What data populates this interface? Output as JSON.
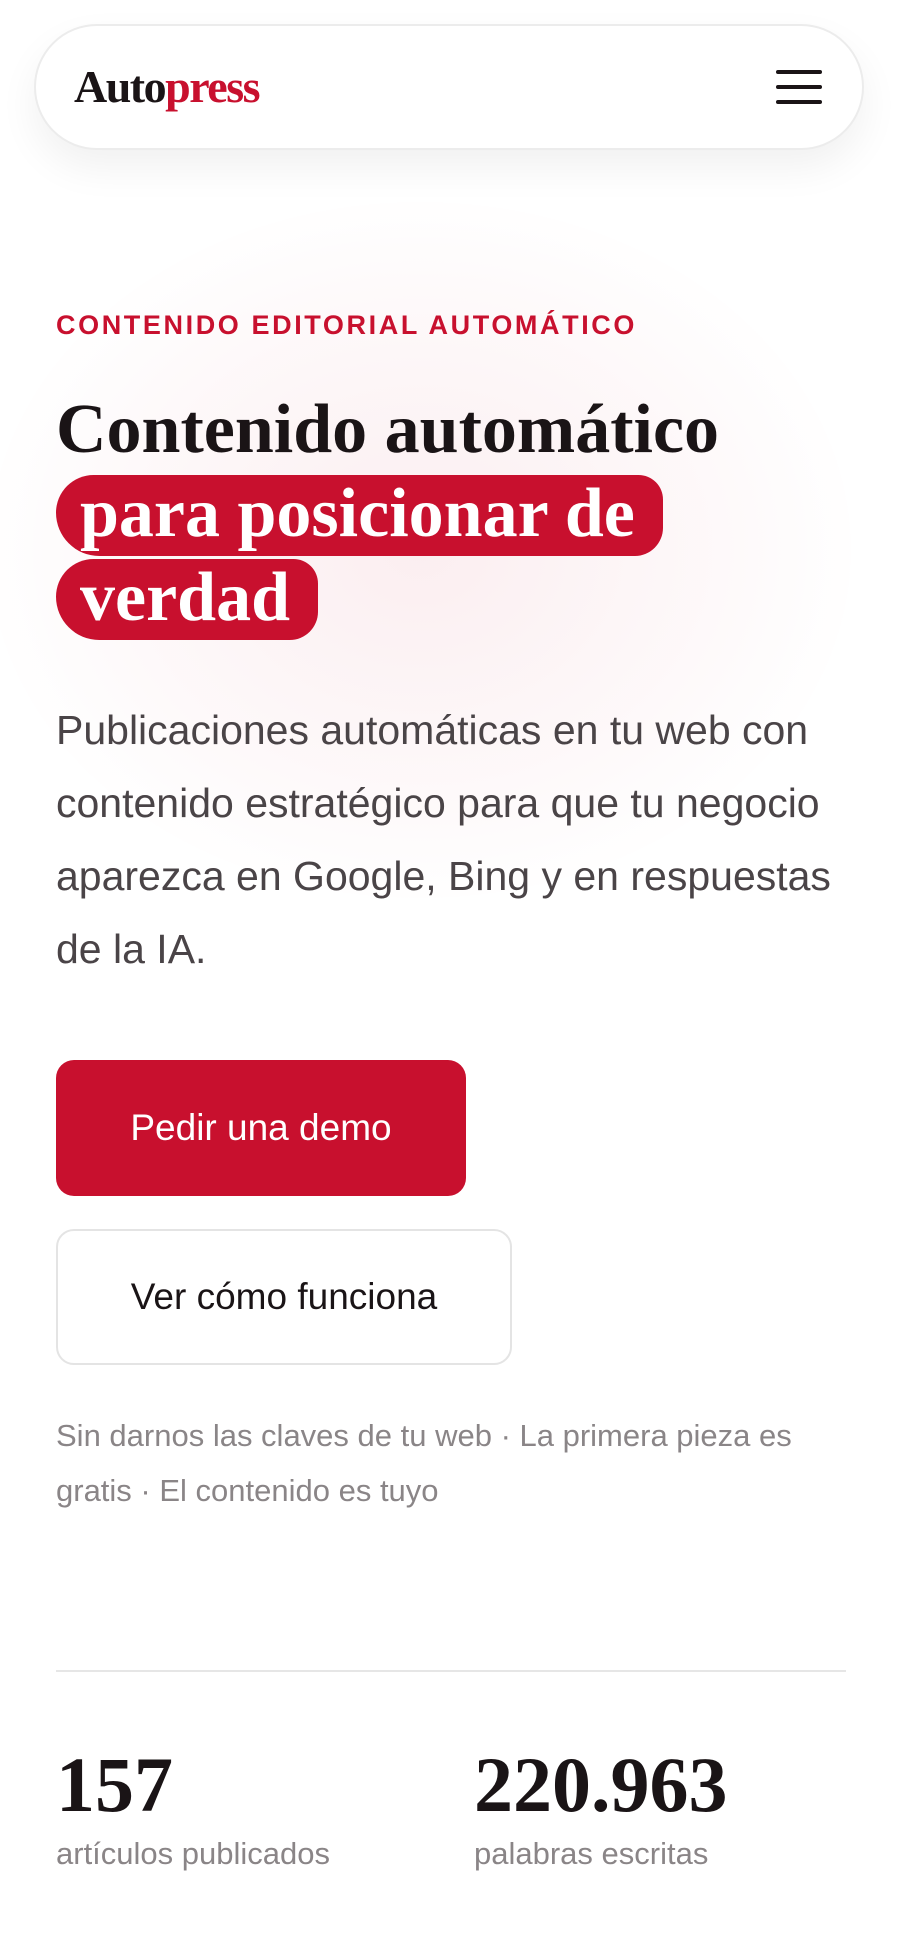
{
  "header": {
    "logo_part1": "Auto",
    "logo_part2": "press",
    "menu_icon": "hamburger-menu-icon"
  },
  "hero": {
    "eyebrow": "CONTENIDO EDITORIAL AUTOMÁTICO",
    "headline_plain": "Contenido automático",
    "headline_highlight": "para posicionar de verdad",
    "lead": "Publicaciones automáticas en tu web con contenido estratégico para que tu negocio aparezca en Google, Bing y en respuestas de la IA.",
    "primary_cta": "Pedir una demo",
    "secondary_cta": "Ver cómo funciona",
    "fineprint": "Sin darnos las claves de tu web · La primera pieza es gratis · El contenido es tuyo"
  },
  "stats": [
    {
      "value": "157",
      "label": "artículos publicados"
    },
    {
      "value": "220.963",
      "label": "palabras escritas"
    }
  ],
  "colors": {
    "brand": "#c8102e",
    "text": "#1a1416",
    "muted": "#8a8587"
  }
}
